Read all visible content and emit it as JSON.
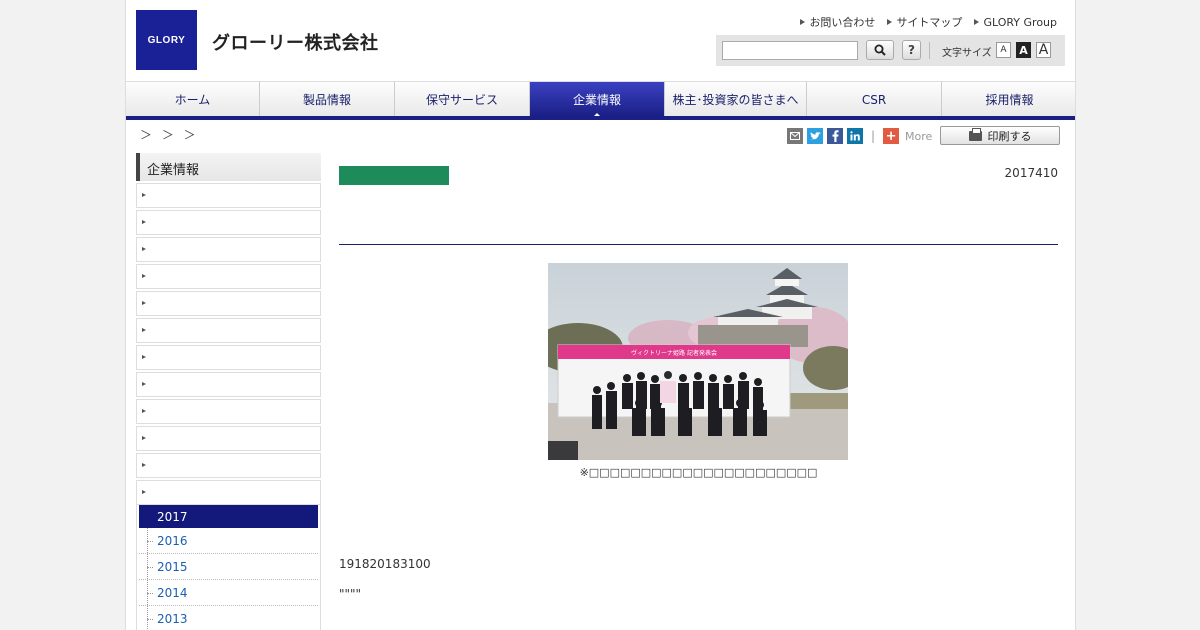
{
  "header": {
    "logo_text": "GLORY",
    "company_name": "グローリー株式会社",
    "util_links": [
      "お問い合わせ",
      "サイトマップ",
      "GLORY Group"
    ],
    "search_placeholder": "",
    "help_label": "?",
    "font_size_label": "文字サイズ",
    "font_sizes": [
      "A",
      "A",
      "A"
    ]
  },
  "nav": {
    "items": [
      {
        "label": "ホーム"
      },
      {
        "label": "製品情報"
      },
      {
        "label": "保守サービス"
      },
      {
        "label": "企業情報"
      },
      {
        "label": "株主･投資家の皆さまへ"
      },
      {
        "label": "CSR"
      },
      {
        "label": "採用情報"
      }
    ]
  },
  "breadcrumb": "＞ ＞ ＞",
  "share": {
    "plus_label": "+",
    "more_label": "More",
    "print_label": "印刷する"
  },
  "sidebar": {
    "title": "企業情報",
    "active_year": "2017",
    "years": [
      "2016",
      "2015",
      "2014",
      "2013"
    ]
  },
  "article": {
    "date": "2017410",
    "caption": "※□□□□□□□□□□□□□□□□□□□□□□",
    "para1": "191820183100",
    "para2": "\"\"\"\""
  },
  "photo_banner": {
    "title": "ヴィクトリーナ姫路 記者発表会"
  },
  "colors": {
    "brand": "#1a2196",
    "nav_active": "#1a1f85",
    "tag_green": "#1e8c5a",
    "link": "#1a5fb4"
  }
}
